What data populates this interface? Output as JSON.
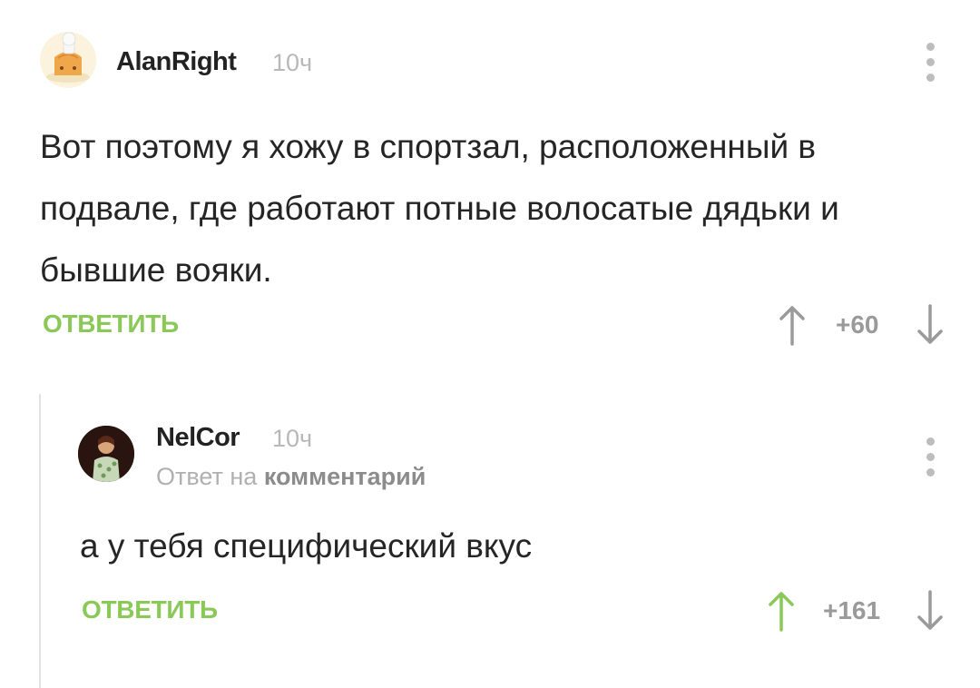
{
  "comments": [
    {
      "username": "AlanRight",
      "time": "10ч",
      "text": "Вот поэтому я хожу в спортзал, расположенный в подвале, где работают потные волосатые дядьки и бывшие вояки.",
      "reply_label": "ОТВЕТИТЬ",
      "rating": "+60",
      "upvoted": false
    },
    {
      "username": "NelCor",
      "time": "10ч",
      "reply_prefix": "Ответ на",
      "reply_target": "комментарий",
      "text": "а у тебя специфический вкус",
      "reply_label": "ОТВЕТИТЬ",
      "rating": "+161",
      "upvoted": true
    }
  ],
  "colors": {
    "accent_green": "#8ac858",
    "arrow_gray": "#9a9a9a",
    "time_gray": "#b8b8b8"
  },
  "icons": {
    "menu": "vertical-dots-icon",
    "upvote": "arrow-up-icon",
    "downvote": "arrow-down-icon"
  }
}
